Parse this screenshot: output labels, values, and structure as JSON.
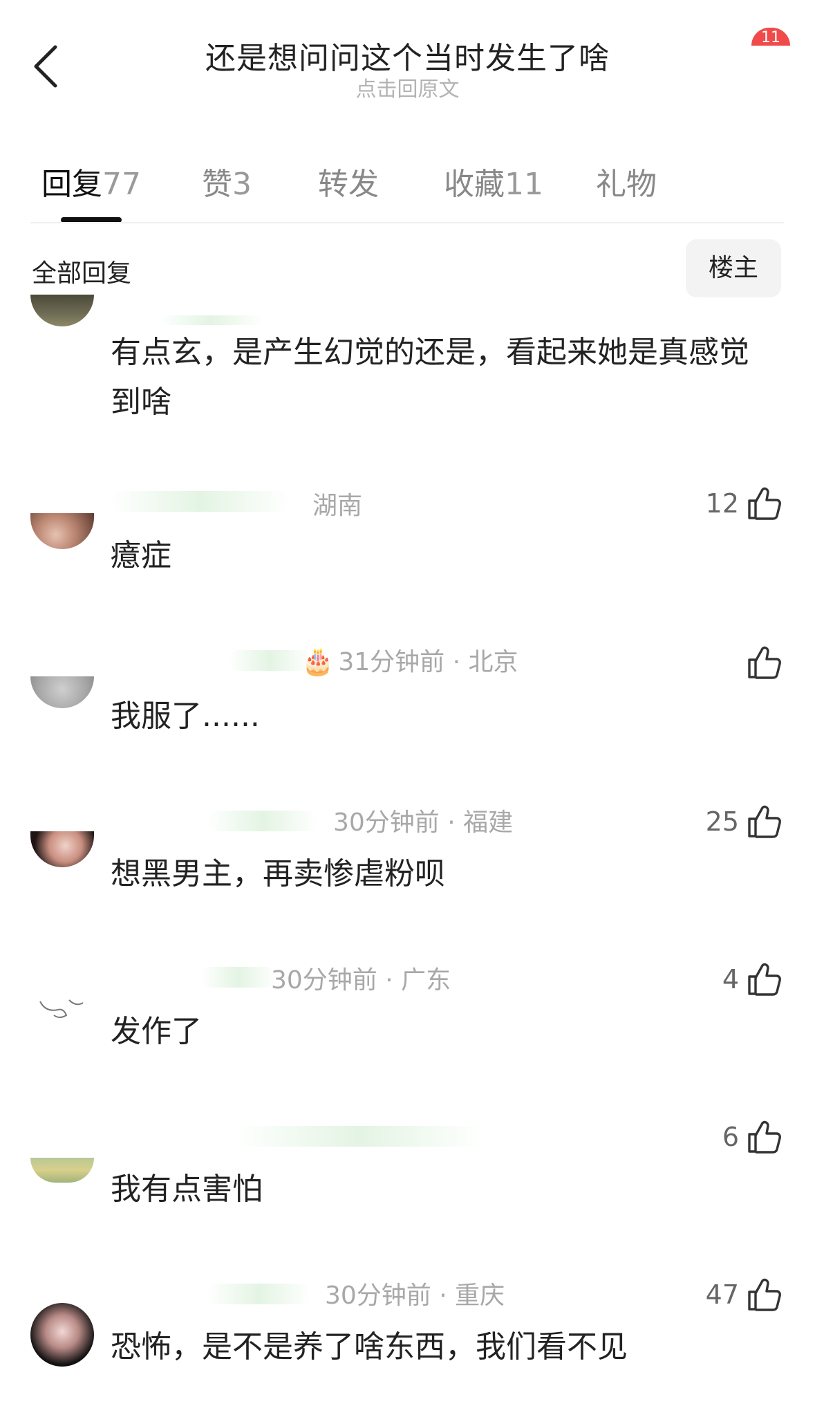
{
  "header": {
    "title": "还是想问问这个当时发生了啥",
    "subtitle": "点击回原文",
    "badge": "11"
  },
  "tabs": [
    {
      "label": "回复",
      "count": "77",
      "active": true
    },
    {
      "label": "赞",
      "count": "3",
      "active": false
    },
    {
      "label": "转发",
      "count": "",
      "active": false
    },
    {
      "label": "收藏",
      "count": "11",
      "active": false
    },
    {
      "label": "礼物",
      "count": "",
      "active": false
    }
  ],
  "filter": {
    "label": "全部回复",
    "op_button": "楼主"
  },
  "comments": [
    {
      "meta": "",
      "likes": "",
      "text": "有点玄，是产生幻觉的还是，看起来她是真感觉到啥"
    },
    {
      "meta": "湖南",
      "likes": "12",
      "text": "癔症"
    },
    {
      "meta": "31分钟前 · 北京",
      "likes": "",
      "text": "我服了......",
      "cake_icon": "birthday-cake-icon"
    },
    {
      "meta": "30分钟前 · 福建",
      "likes": "25",
      "text": "想黑男主，再卖惨虐粉呗"
    },
    {
      "meta": "30分钟前 · 广东",
      "likes": "4",
      "text": "发作了"
    },
    {
      "meta": "",
      "likes": "6",
      "text": "我有点害怕"
    },
    {
      "meta": "30分钟前 · 重庆",
      "likes": "47",
      "text": "恐怖，是不是养了啥东西，我们看不见"
    }
  ],
  "colors": {
    "text_primary": "#222222",
    "text_secondary": "#a8a8a8",
    "badge": "#f04a4a",
    "tab_indicator": "#111111"
  }
}
